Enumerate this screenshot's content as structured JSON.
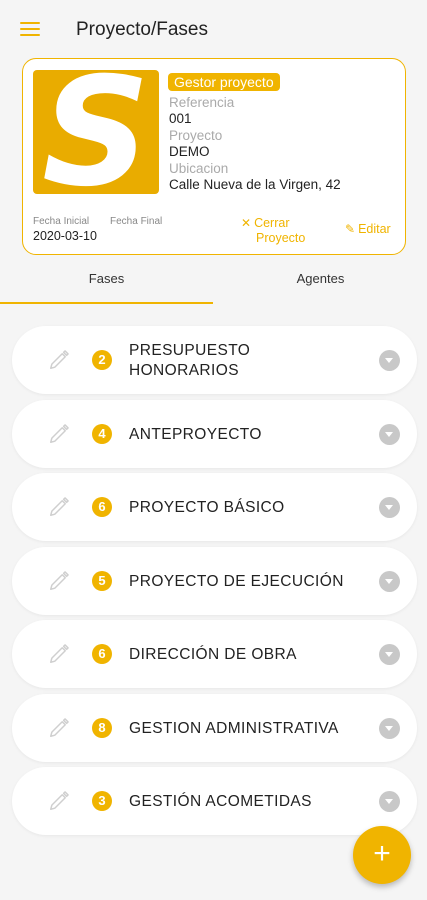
{
  "header": {
    "title": "Proyecto/Fases"
  },
  "project": {
    "logo_letter": "S",
    "role": "Gestor proyecto",
    "ref_label": "Referencia",
    "ref_value": "001",
    "project_label": "Proyecto",
    "project_value": "DEMO",
    "location_label": "Ubicacion",
    "location_value": "Calle Nueva de la Virgen, 42",
    "start_label": "Fecha Inicial",
    "start_value": "2020-03-10",
    "end_label": "Fecha Final",
    "end_value": "",
    "close_line1": "Cerrar",
    "close_line2": "Proyecto",
    "edit_label": "Editar"
  },
  "tabs": [
    {
      "label": "Fases"
    },
    {
      "label": "Agentes"
    }
  ],
  "phases": [
    {
      "count": "2",
      "line1": "PRESUPUESTO",
      "line2": "HONORARIOS"
    },
    {
      "count": "4",
      "line1": "ANTEPROYECTO",
      "line2": ""
    },
    {
      "count": "6",
      "line1": "PROYECTO BÁSICO",
      "line2": ""
    },
    {
      "count": "5",
      "line1": "PROYECTO DE EJECUCIÓN",
      "line2": ""
    },
    {
      "count": "6",
      "line1": "DIRECCIÓN DE OBRA",
      "line2": ""
    },
    {
      "count": "8",
      "line1": "GESTION ADMINISTRATIVA",
      "line2": ""
    },
    {
      "count": "3",
      "line1": "GESTIÓN ACOMETIDAS",
      "line2": ""
    }
  ],
  "fab": {
    "label": "+"
  },
  "colors": {
    "accent": "#f0b400",
    "logo_bg": "#e9ac00",
    "chevron": "#c8c8c8"
  }
}
